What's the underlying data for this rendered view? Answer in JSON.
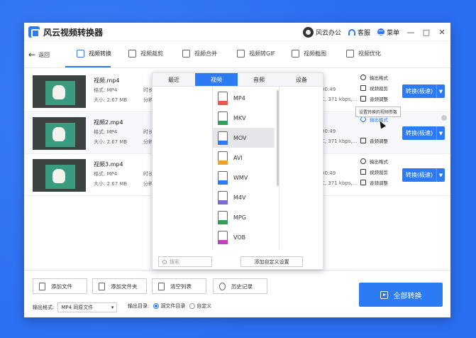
{
  "app": {
    "title": "风云视频转换器",
    "accent": "#2d7bf4"
  },
  "titlebar": {
    "account": "风云办公",
    "service": "客服",
    "menu": "菜单",
    "min": "—",
    "max": "□",
    "close": "✕"
  },
  "nav": {
    "back": "返回",
    "tabs": [
      "视频转换",
      "视频裁剪",
      "视频合并",
      "视频转GIF",
      "视频截图",
      "视频优化"
    ],
    "active_tab": 0
  },
  "files": [
    {
      "name": "视频.mp4",
      "format": "格式: MP4",
      "size": "大小: 2.67 MB",
      "col2a": "时长",
      "col2b": "分辨",
      "right1": "00:49",
      "right2": "C, 371 kbps,..."
    },
    {
      "name": "视频2.mp4",
      "format": "格式: MP4",
      "size": "大小: 2.67 MB",
      "col2a": "时长",
      "col2b": "分辨",
      "right1": "00:49",
      "right2": "C, 371 kbps,..."
    },
    {
      "name": "视频3.mp4",
      "format": "格式: MP4",
      "size": "大小: 2.67 MB",
      "col2a": "时长",
      "col2b": "分辨",
      "right1": "00:49",
      "right2": "C, 371 kbps,..."
    }
  ],
  "row_actions": {
    "output_format": "输出格式",
    "edit": "视频裁剪",
    "subtitle": "音频调整"
  },
  "convert_btn": "转换(极速)",
  "tooltip": "设置转换的视频参数",
  "panel": {
    "tabs": [
      "最近",
      "视频",
      "音频",
      "设备"
    ],
    "active_tab": 1,
    "formats": [
      {
        "label": "MP4",
        "color": "#e85a4f"
      },
      {
        "label": "MKV",
        "color": "#2e9e5a"
      },
      {
        "label": "MOV",
        "color": "#2d7bf4"
      },
      {
        "label": "AVI",
        "color": "#f0a030"
      },
      {
        "label": "WMV",
        "color": "#2d7bf4"
      },
      {
        "label": "M4V",
        "color": "#7a6ad8"
      },
      {
        "label": "MPG",
        "color": "#2e9e5a"
      },
      {
        "label": "VOB",
        "color": "#c040c0"
      }
    ],
    "selected_format": 2,
    "search_placeholder": "搜索",
    "custom_btn": "添加自定义设置"
  },
  "bottom": {
    "add_file": "添加文件",
    "add_folder": "添加文件夹",
    "clear": "清空列表",
    "history": "历史记录",
    "output_format_label": "输出格式:",
    "output_format_value": "MP4 同原文件",
    "output_dir_label": "输出目录:",
    "dir_source": "源文件目录",
    "dir_custom": "自定义",
    "convert_all": "全部转换"
  }
}
